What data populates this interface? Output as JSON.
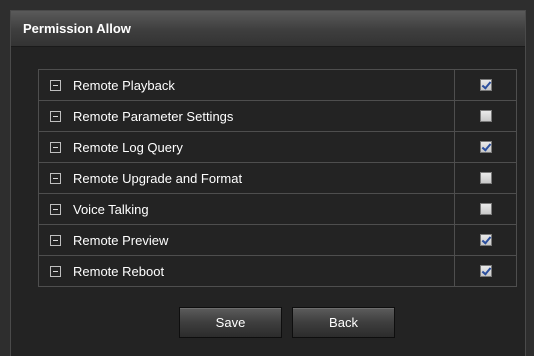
{
  "panel": {
    "title": "Permission Allow"
  },
  "permissions": [
    {
      "label": "Remote Playback",
      "checked": true
    },
    {
      "label": "Remote Parameter Settings",
      "checked": false
    },
    {
      "label": "Remote Log Query",
      "checked": true
    },
    {
      "label": "Remote Upgrade and Format",
      "checked": false
    },
    {
      "label": "Voice Talking",
      "checked": false
    },
    {
      "label": "Remote Preview",
      "checked": true
    },
    {
      "label": "Remote Reboot",
      "checked": true
    }
  ],
  "buttons": {
    "save_label": "Save",
    "back_label": "Back"
  },
  "icons": {
    "row_icon": "minus-square-icon"
  },
  "colors": {
    "background": "#232323",
    "checkmark": "#2b4f9e"
  }
}
